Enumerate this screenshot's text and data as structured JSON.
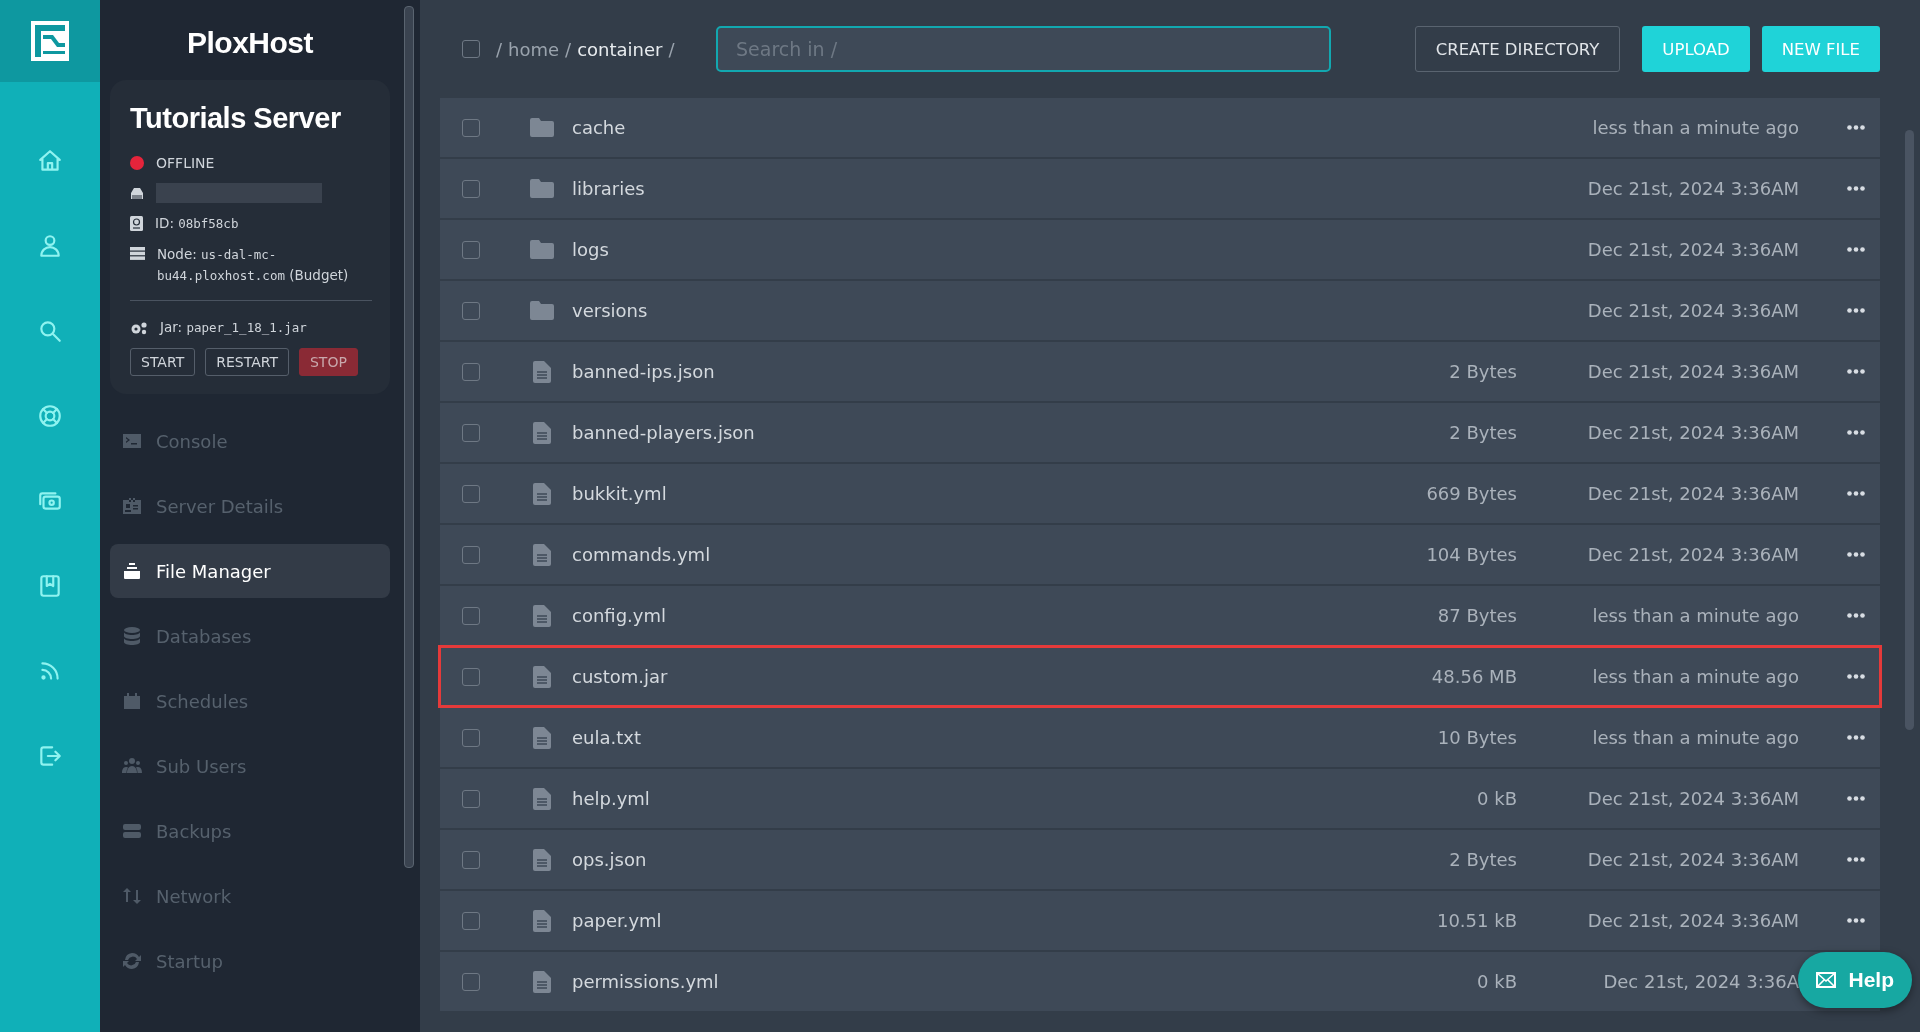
{
  "brand": {
    "name": "PloxHost"
  },
  "rail": [
    {
      "kind": "home"
    },
    {
      "kind": "user"
    },
    {
      "kind": "search"
    },
    {
      "kind": "lifebuoy"
    },
    {
      "kind": "money"
    },
    {
      "kind": "book"
    },
    {
      "kind": "rss"
    },
    {
      "kind": "logout"
    }
  ],
  "server": {
    "name": "Tutorials Server",
    "status": "OFFLINE",
    "id_label": "ID:",
    "id": "08bf58cb",
    "node_label": "Node:",
    "node": "us-dal-mc-bu44.ploxhost.com",
    "node_plan": "(Budget)",
    "jar_label": "Jar:",
    "jar": "paper_1_18_1.jar",
    "buttons": [
      {
        "label": "START",
        "kind": "plain"
      },
      {
        "label": "RESTART",
        "kind": "plain"
      },
      {
        "label": "STOP",
        "kind": "danger"
      }
    ]
  },
  "nav": [
    {
      "label": "Console",
      "selected": false
    },
    {
      "label": "Server Details",
      "selected": false
    },
    {
      "label": "File Manager",
      "selected": true
    },
    {
      "label": "Databases",
      "selected": false
    },
    {
      "label": "Schedules",
      "selected": false
    },
    {
      "label": "Sub Users",
      "selected": false
    },
    {
      "label": "Backups",
      "selected": false
    },
    {
      "label": "Network",
      "selected": false
    },
    {
      "label": "Startup",
      "selected": false
    }
  ],
  "toolbar": {
    "select_all": {
      "checked": false
    },
    "breadcrumb": {
      "separator": "/",
      "segments": [
        {
          "label": "home",
          "current": false
        },
        {
          "label": "container",
          "current": true
        }
      ]
    },
    "search": {
      "placeholder": "Search in /"
    },
    "buttons": [
      {
        "label": "CREATE DIRECTORY",
        "kind": "outline"
      },
      {
        "label": "UPLOAD",
        "kind": "primary"
      },
      {
        "label": "NEW FILE",
        "kind": "primary"
      }
    ]
  },
  "files": [
    {
      "kind": "folder",
      "name": "cache",
      "modified": "less than a minute ago",
      "checked": false,
      "highlighted": false
    },
    {
      "kind": "folder",
      "name": "libraries",
      "modified": "Dec 21st, 2024 3:36AM",
      "checked": false,
      "highlighted": false
    },
    {
      "kind": "folder",
      "name": "logs",
      "modified": "Dec 21st, 2024 3:36AM",
      "checked": false,
      "highlighted": false
    },
    {
      "kind": "folder",
      "name": "versions",
      "modified": "Dec 21st, 2024 3:36AM",
      "checked": false,
      "highlighted": false
    },
    {
      "kind": "file",
      "name": "banned-ips.json",
      "size": "2 Bytes",
      "modified": "Dec 21st, 2024 3:36AM",
      "checked": false,
      "highlighted": false
    },
    {
      "kind": "file",
      "name": "banned-players.json",
      "size": "2 Bytes",
      "modified": "Dec 21st, 2024 3:36AM",
      "checked": false,
      "highlighted": false
    },
    {
      "kind": "file",
      "name": "bukkit.yml",
      "size": "669 Bytes",
      "modified": "Dec 21st, 2024 3:36AM",
      "checked": false,
      "highlighted": false
    },
    {
      "kind": "file",
      "name": "commands.yml",
      "size": "104 Bytes",
      "modified": "Dec 21st, 2024 3:36AM",
      "checked": false,
      "highlighted": false
    },
    {
      "kind": "file",
      "name": "config.yml",
      "size": "87 Bytes",
      "modified": "less than a minute ago",
      "checked": false,
      "highlighted": false
    },
    {
      "kind": "file",
      "name": "custom.jar",
      "size": "48.56 MB",
      "modified": "less than a minute ago",
      "checked": false,
      "highlighted": true
    },
    {
      "kind": "file",
      "name": "eula.txt",
      "size": "10 Bytes",
      "modified": "less than a minute ago",
      "checked": false,
      "highlighted": false
    },
    {
      "kind": "file",
      "name": "help.yml",
      "size": "0 kB",
      "modified": "Dec 21st, 2024 3:36AM",
      "checked": false,
      "highlighted": false
    },
    {
      "kind": "file",
      "name": "ops.json",
      "size": "2 Bytes",
      "modified": "Dec 21st, 2024 3:36AM",
      "checked": false,
      "highlighted": false
    },
    {
      "kind": "file",
      "name": "paper.yml",
      "size": "10.51 kB",
      "modified": "Dec 21st, 2024 3:36AM",
      "checked": false,
      "highlighted": false
    },
    {
      "kind": "file",
      "name": "permissions.yml",
      "size": "0 kB",
      "modified": "Dec 21st, 2024 3:36A",
      "checked": false,
      "highlighted": false
    }
  ],
  "help": {
    "label": "Help"
  }
}
